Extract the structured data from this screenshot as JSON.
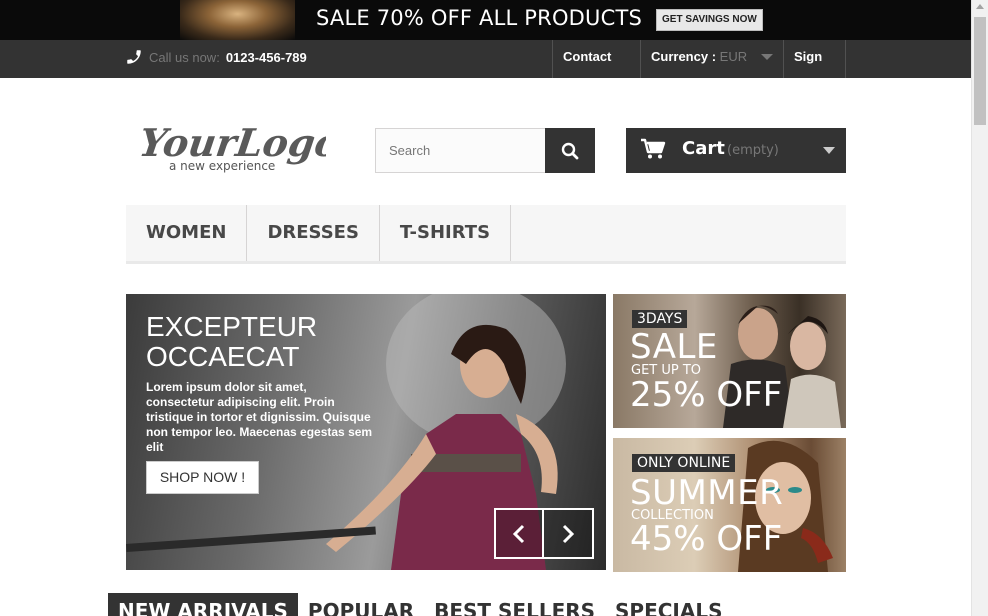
{
  "promo": {
    "text": "SALE 70% OFF ALL PRODUCTS",
    "button": "GET SAVINGS NOW"
  },
  "navbar": {
    "call_label": "Call us now:",
    "phone": "0123-456-789",
    "contact": "Contact us",
    "currency_label": "Currency :",
    "currency_value": "EUR",
    "signin": "Sign in"
  },
  "header": {
    "logo_text": "YourLogo",
    "logo_tagline": "a new experience",
    "search_placeholder": "Search",
    "cart_label": "Cart",
    "cart_status": "(empty)"
  },
  "menu": {
    "items": [
      "WOMEN",
      "DRESSES",
      "T-SHIRTS"
    ]
  },
  "slider": {
    "title": "EXCEPTEUR OCCAECAT",
    "text": "Lorem ipsum dolor sit amet, consectetur adipiscing elit. Proin tristique in tortor et dignissim. Quisque non tempor leo. Maecenas egestas sem elit",
    "button": "SHOP NOW !"
  },
  "banners": [
    {
      "tag": "3DAYS",
      "big": "SALE",
      "small": "GET UP TO",
      "pct": "25% OFF"
    },
    {
      "tag": "ONLY ONLINE",
      "big": "SUMMER",
      "small": "COLLECTION",
      "pct": "45% OFF"
    }
  ],
  "tabs": [
    "NEW ARRIVALS",
    "POPULAR",
    "BEST SELLERS",
    "SPECIALS"
  ],
  "colors": {
    "dark": "#333333",
    "promo_bg": "#0a0a0a",
    "menu_bg": "#f6f6f6"
  }
}
